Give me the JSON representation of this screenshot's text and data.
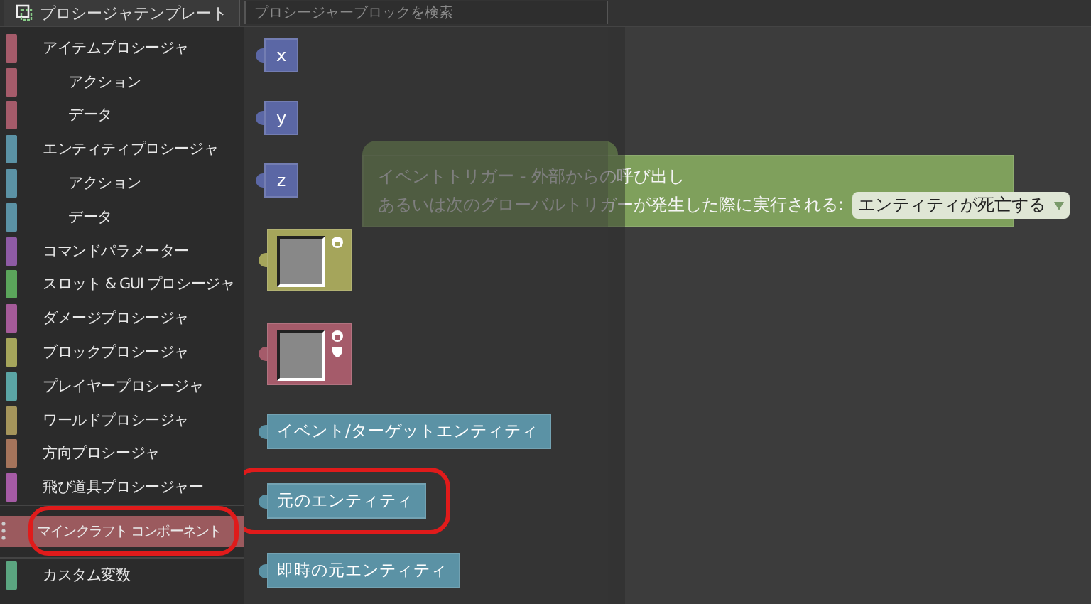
{
  "toolbar": {
    "template_button": "プロシージャテンプレート",
    "search": {
      "placeholder": "プロシージャーブロックを検索"
    }
  },
  "categories": [
    {
      "label": "アイテムプロシージャ",
      "color": "#a55b6a",
      "selected": false,
      "circled": false,
      "children": [
        {
          "label": "アクション",
          "color": "#a55b6a",
          "selected": false,
          "circled": false
        },
        {
          "label": "データ",
          "color": "#a55b6a",
          "selected": false,
          "circled": false
        }
      ]
    },
    {
      "label": "エンティティプロシージャ",
      "color": "#5b92a5",
      "selected": false,
      "circled": false,
      "children": [
        {
          "label": "アクション",
          "color": "#5b92a5",
          "selected": false,
          "circled": false
        },
        {
          "label": "データ",
          "color": "#5b92a5",
          "selected": false,
          "circled": false
        }
      ]
    },
    {
      "label": "コマンドパラメーター",
      "color": "#8e5ba5",
      "selected": false,
      "circled": false
    },
    {
      "label": "スロット & GUI プロシージャ",
      "color": "#5ba55b",
      "selected": false,
      "circled": false
    },
    {
      "label": "ダメージプロシージャ",
      "color": "#a55b99",
      "selected": false,
      "circled": false
    },
    {
      "label": "ブロックプロシージャ",
      "color": "#a5a55b",
      "selected": false,
      "circled": false
    },
    {
      "label": "プレイヤープロシージャ",
      "color": "#5ba5a5",
      "selected": false,
      "circled": false
    },
    {
      "label": "ワールドプロシージャ",
      "color": "#a5955b",
      "selected": false,
      "circled": false
    },
    {
      "label": "方向プロシージャ",
      "color": "#a5745b",
      "selected": false,
      "circled": false
    },
    {
      "label": "飛び道具プロシージャー",
      "color": "#a55ba5",
      "selected": false,
      "circled": false
    },
    {
      "label": "マインクラフト コンポーネント",
      "color": "#9b5a5e",
      "selected": true,
      "circled": true
    },
    {
      "label": "カスタム変数",
      "color": "#5ba580",
      "selected": false,
      "circled": false
    }
  ],
  "flyout_blocks": [
    {
      "kind": "variable",
      "label": "x",
      "color": "#5b67a5",
      "circled": false
    },
    {
      "kind": "variable",
      "label": "y",
      "color": "#5b67a5",
      "circled": false
    },
    {
      "kind": "variable",
      "label": "z",
      "color": "#5b67a5",
      "circled": false
    },
    {
      "kind": "item_image",
      "color": "#a5a55b",
      "circled": false
    },
    {
      "kind": "entity_image",
      "color": "#a55b6a",
      "circled": false
    },
    {
      "kind": "entity",
      "label": "イベント/ターゲットエンティティ",
      "color": "#5b92a5",
      "circled": false
    },
    {
      "kind": "entity",
      "label": "元のエンティティ",
      "color": "#5b92a5",
      "circled": true
    },
    {
      "kind": "entity",
      "label": "即時の元エンティティ",
      "color": "#5b92a5",
      "circled": false
    }
  ],
  "event_block": {
    "line_1": "イベントトリガー - 外部からの呼び出し",
    "line_2": "あるいは次のグローバルトリガーが発生した際に実行される:",
    "dropdown": "エンティティが死亡する"
  }
}
